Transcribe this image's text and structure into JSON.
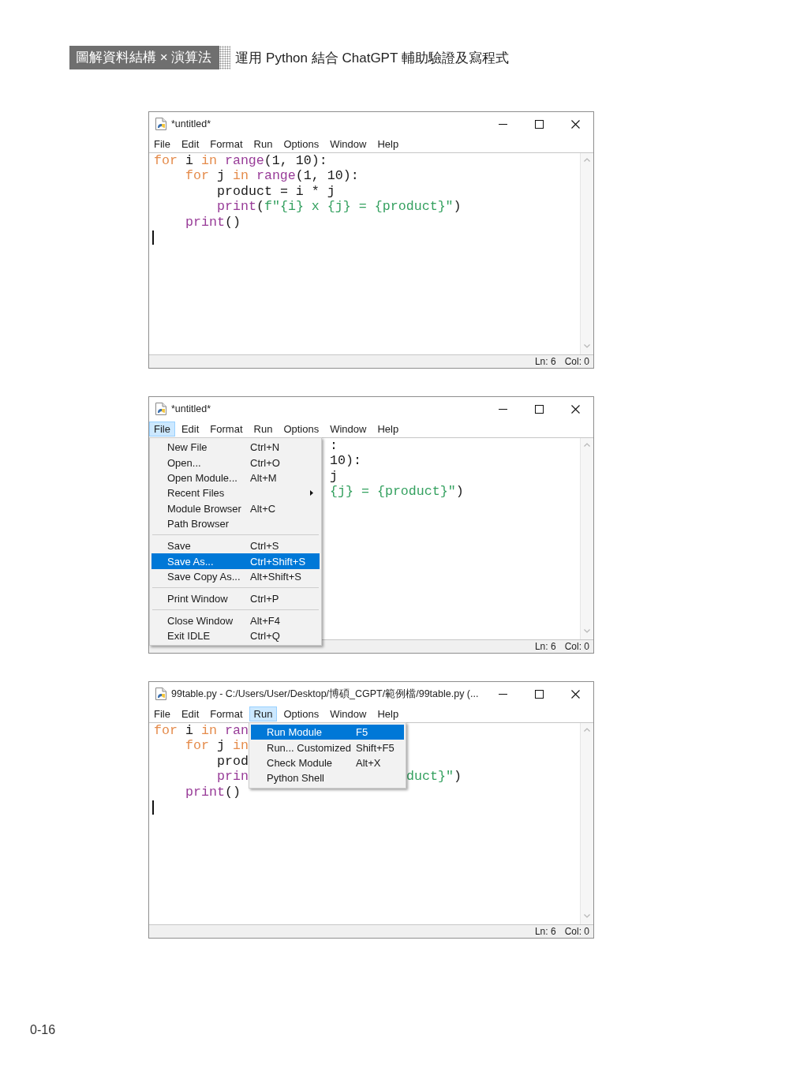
{
  "header": {
    "book_title": "圖解資料結構 × 演算法",
    "subtitle": "運用 Python 結合 ChatGPT 輔助驗證及寫程式"
  },
  "windows": [
    {
      "title": "*untitled*",
      "menu_bar": [
        {
          "label": "File",
          "selected": false
        },
        {
          "label": "Edit",
          "selected": false
        },
        {
          "label": "Format",
          "selected": false
        },
        {
          "label": "Run",
          "selected": false
        },
        {
          "label": "Options",
          "selected": false
        },
        {
          "label": "Window",
          "selected": false
        },
        {
          "label": "Help",
          "selected": false
        }
      ],
      "editor": {
        "lines": [
          {
            "tokens": [
              {
                "kind": "keyword",
                "text": "for"
              },
              {
                "kind": "plain",
                "text": " i "
              },
              {
                "kind": "keyword",
                "text": "in"
              },
              {
                "kind": "builtin",
                "text": " range"
              },
              {
                "kind": "plain",
                "text": "(1, 10):"
              }
            ],
            "children": [
              {
                "tokens": [
                  {
                    "kind": "keyword",
                    "text": "for"
                  },
                  {
                    "kind": "plain",
                    "text": " j "
                  },
                  {
                    "kind": "keyword",
                    "text": "in"
                  },
                  {
                    "kind": "builtin",
                    "text": " range"
                  },
                  {
                    "kind": "plain",
                    "text": "(1, 10):"
                  }
                ],
                "children": [
                  {
                    "tokens": [
                      {
                        "kind": "plain",
                        "text": "product = i * j"
                      }
                    ]
                  },
                  {
                    "tokens": [
                      {
                        "kind": "builtin",
                        "text": "print"
                      },
                      {
                        "kind": "plain",
                        "text": "("
                      },
                      {
                        "kind": "string",
                        "text": "f\"{i} x {j} = {product}\""
                      },
                      {
                        "kind": "plain",
                        "text": ")"
                      }
                    ]
                  }
                ]
              },
              {
                "tokens": [
                  {
                    "kind": "builtin",
                    "text": "print"
                  },
                  {
                    "kind": "plain",
                    "text": "()"
                  }
                ]
              }
            ]
          }
        ],
        "cursor": true
      },
      "status_bar": {
        "line": "Ln: 6",
        "column": "Col: 0"
      }
    },
    {
      "title": "*untitled*",
      "menu_bar": [
        {
          "label": "File",
          "selected": true
        },
        {
          "label": "Edit",
          "selected": false
        },
        {
          "label": "Format",
          "selected": false
        },
        {
          "label": "Run",
          "selected": false
        },
        {
          "label": "Options",
          "selected": false
        },
        {
          "label": "Window",
          "selected": false
        },
        {
          "label": "Help",
          "selected": false
        }
      ],
      "open_menu": {
        "sections": [
          {
            "items": [
              {
                "label": "New File",
                "shortcut": "Ctrl+N",
                "has_submenu": false,
                "selected": false
              },
              {
                "label": "Open...",
                "shortcut": "Ctrl+O",
                "has_submenu": false,
                "selected": false
              },
              {
                "label": "Open Module...",
                "shortcut": "Alt+M",
                "has_submenu": false,
                "selected": false
              },
              {
                "label": "Recent Files",
                "has_submenu": true,
                "selected": false
              },
              {
                "label": "Module Browser",
                "shortcut": "Alt+C",
                "has_submenu": false,
                "selected": false
              },
              {
                "label": "Path Browser",
                "has_submenu": false,
                "selected": false
              }
            ]
          },
          {
            "items": [
              {
                "label": "Save",
                "shortcut": "Ctrl+S",
                "has_submenu": false,
                "selected": false
              },
              {
                "label": "Save As...",
                "shortcut": "Ctrl+Shift+S",
                "has_submenu": false,
                "selected": true
              },
              {
                "label": "Save Copy As...",
                "shortcut": "Alt+Shift+S",
                "has_submenu": false,
                "selected": false
              }
            ]
          },
          {
            "items": [
              {
                "label": "Print Window",
                "shortcut": "Ctrl+P",
                "has_submenu": false,
                "selected": false
              }
            ]
          },
          {
            "items": [
              {
                "label": "Close Window",
                "shortcut": "Alt+F4",
                "has_submenu": false,
                "selected": false
              },
              {
                "label": "Exit IDLE",
                "shortcut": "Ctrl+Q",
                "has_submenu": false,
                "selected": false
              }
            ]
          }
        ]
      },
      "editor": {
        "lines": [
          {
            "tokens_right_of_menu": [
              {
                "kind": "plain",
                "text": ":"
              }
            ]
          },
          {
            "tokens_right_of_menu": [
              {
                "kind": "plain",
                "text": "10):"
              }
            ]
          },
          {
            "tokens_right_of_menu": [
              {
                "kind": "plain",
                "text": "j"
              }
            ]
          },
          {
            "tokens_right_of_menu": [
              {
                "kind": "string",
                "text": "{j} = {product}\""
              },
              {
                "kind": "plain",
                "text": ")"
              }
            ]
          }
        ]
      },
      "status_bar": {
        "line": "Ln: 6",
        "column": "Col: 0"
      }
    },
    {
      "title": "99table.py - C:/Users/User/Desktop/博碩_CGPT/範例檔/99table.py (...",
      "menu_bar": [
        {
          "label": "File",
          "selected": false
        },
        {
          "label": "Edit",
          "selected": false
        },
        {
          "label": "Format",
          "selected": false
        },
        {
          "label": "Run",
          "selected": true
        },
        {
          "label": "Options",
          "selected": false
        },
        {
          "label": "Window",
          "selected": false
        },
        {
          "label": "Help",
          "selected": false
        }
      ],
      "open_menu": {
        "sections": [
          {
            "items": [
              {
                "label": "Run Module",
                "shortcut": "F5",
                "has_submenu": false,
                "selected": true
              },
              {
                "label": "Run... Customized",
                "shortcut": "Shift+F5",
                "has_submenu": false,
                "selected": false
              },
              {
                "label": "Check Module",
                "shortcut": "Alt+X",
                "has_submenu": false,
                "selected": false
              },
              {
                "label": "Python Shell",
                "has_submenu": false,
                "selected": false
              }
            ]
          }
        ]
      },
      "editor": {
        "lines": [
          {
            "tokens": [
              {
                "kind": "keyword",
                "text": "for"
              },
              {
                "kind": "plain",
                "text": " i "
              },
              {
                "kind": "keyword",
                "text": "in"
              },
              {
                "kind": "builtin",
                "text": " ran"
              }
            ],
            "children": [
              {
                "tokens": [
                  {
                    "kind": "keyword",
                    "text": "for"
                  },
                  {
                    "kind": "plain",
                    "text": " j "
                  },
                  {
                    "kind": "keyword",
                    "text": "in"
                  }
                ],
                "children": [
                  {
                    "tokens": [
                      {
                        "kind": "plain",
                        "text": "prod"
                      }
                    ]
                  },
                  {
                    "tokens": [
                      {
                        "kind": "builtin",
                        "text": "prin"
                      }
                    ],
                    "tokens_right_of_menu": [
                      {
                        "kind": "string",
                        "text": "duct}\""
                      },
                      {
                        "kind": "plain",
                        "text": ")"
                      }
                    ]
                  }
                ]
              },
              {
                "tokens": [
                  {
                    "kind": "builtin",
                    "text": "print"
                  },
                  {
                    "kind": "plain",
                    "text": "()"
                  }
                ]
              }
            ]
          }
        ],
        "cursor": true
      },
      "status_bar": {
        "line": "Ln: 6",
        "column": "Col: 0"
      }
    }
  ],
  "page_number": "0-16"
}
